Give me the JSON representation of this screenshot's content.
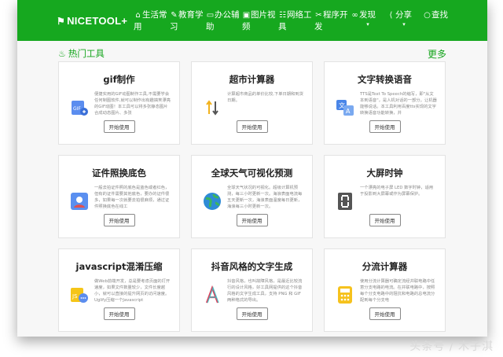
{
  "brand": {
    "logo_text": "NICETOOL+"
  },
  "nav": [
    {
      "icon": "home-icon",
      "glyph": "⌂",
      "label": "生活常用"
    },
    {
      "icon": "graduation-icon",
      "glyph": "✎",
      "label": "教育学习"
    },
    {
      "icon": "briefcase-icon",
      "glyph": "▭",
      "label": "办公辅助"
    },
    {
      "icon": "image-icon",
      "glyph": "▣",
      "label": "图片视频"
    },
    {
      "icon": "network-icon",
      "glyph": "☷",
      "label": "网络工具"
    },
    {
      "icon": "wrench-icon",
      "glyph": "✂",
      "label": "程序开发"
    },
    {
      "icon": "glasses-icon",
      "glyph": "∞",
      "label": "发现",
      "dropdown": true
    },
    {
      "icon": "share-icon",
      "glyph": "⟨",
      "label": "分享",
      "dropdown": true
    },
    {
      "icon": "search-icon",
      "glyph": "○",
      "label": "查找"
    }
  ],
  "section": {
    "title": "热门工具",
    "more": "更多"
  },
  "cards": [
    {
      "title": "gif制作",
      "icon": "gif-icon",
      "desc": "便捷实用的GIF动图制作工具,不需要学会任何制图软件,就可以制作出有趣搞笑漂亮的GIF动图！本工具可以将多张静态图片合成动态图片、多张",
      "button": "开始使用"
    },
    {
      "title": "超市计算器",
      "icon": "sort-arrows-icon",
      "desc": "计算超市商品的单价比较,下单日期和到货日期。",
      "button": "开始使用"
    },
    {
      "title": "文字转换语音",
      "icon": "translate-icon",
      "desc": "TTS是Text To Speech的缩写，即\"从文本到语音\"，是人机对话的一部分。让机器能够说话。本工具利用百度tts实现的文字转换语音功能转换，并",
      "button": "开始使用"
    },
    {
      "title": "证件照换底色",
      "icon": "id-card-icon",
      "desc": "一般去拍证件照的底色是蓝色或者红色，但有的证件需要其他底色，要办的证件很多，如果每一次就要去拍很麻烦，通过证件照换底色在线工",
      "button": "开始使用"
    },
    {
      "title": "全球天气可视化预测",
      "icon": "globe-icon",
      "desc": "全球天气状况的可视化。超级计算机预测，每三小时更新一次。海浪表面电流每五天更新一次，海浪表面温度每日更新，海浪每三小时更新一次。",
      "button": "开始使用"
    },
    {
      "title": "大屏时钟",
      "icon": "digital-clock-icon",
      "desc": "一个漂亮的电子屏 LED 数字时钟，适用于投影到大屏幕或作为屏幕保护。",
      "button": "开始使用"
    },
    {
      "title": "javascript混淆压缩",
      "icon": "js-icon",
      "desc": "做Web前端开发，总是要考虑页面的打开速度，如果文件数量较少，文件长度越小，就可以直接的提升网页的访问速度。Uglify压缩一个Javascript",
      "button": "开始使用"
    },
    {
      "title": "抖音风格的文字生成",
      "icon": "letter-a-icon",
      "desc": "抖音风格，也叫故障风格，是最近比较流行的设计风格，好工具网提供的这个抖音风格的文字生成工具，支持 PNG 和 GIF 两种格式的导出。",
      "button": "开始使用"
    },
    {
      "title": "分流计算器",
      "icon": "calculator-icon",
      "desc": "使用分流计算器可确定流经并联电路中任意分支电路的电流。在并联电路中，按照每个分支电路中的阻抗和电路的总电流分配到每个分支电",
      "button": "开始使用"
    }
  ],
  "watermark": "头条号 / 木子淇",
  "colors": {
    "brand_green": "#16a81f",
    "text_green": "#15a51d"
  }
}
